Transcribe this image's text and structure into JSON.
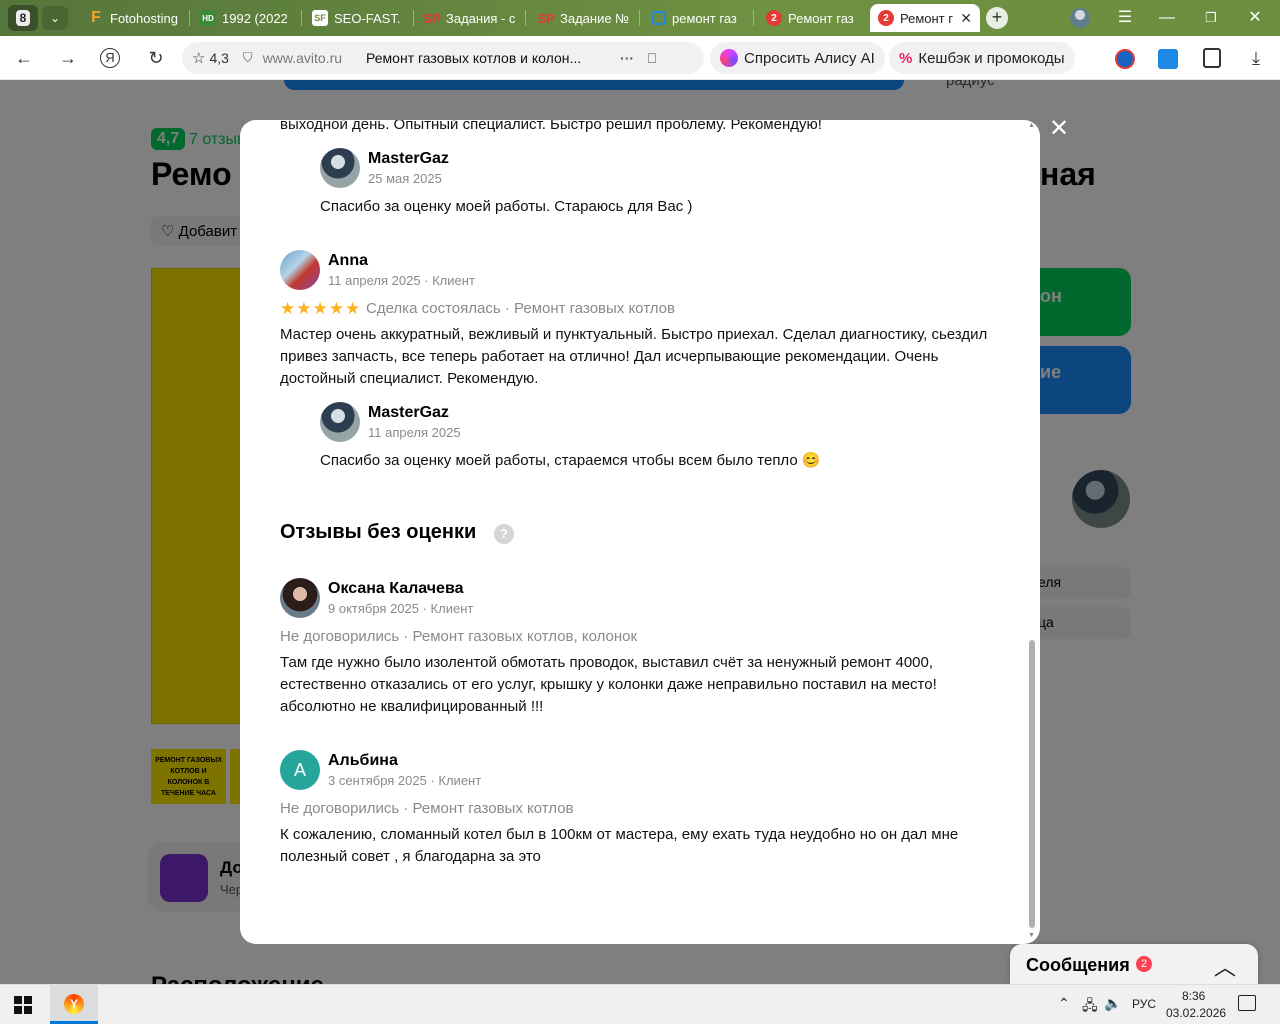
{
  "browser": {
    "tab_counter": "8",
    "tabs": [
      {
        "label": "Fotohosting",
        "fav_text": "F",
        "fav_color": "#f5a623"
      },
      {
        "label": "1992 (2022",
        "fav_text": "HD",
        "fav_color": "#3a8a3a"
      },
      {
        "label": "SEO-FAST.",
        "fav_text": "SF",
        "fav_color": "#ffffff"
      },
      {
        "label": "Задания - с",
        "fav_text": "SP",
        "fav_color": "#e53935"
      },
      {
        "label": "Задание №",
        "fav_text": "SP",
        "fav_color": "#e53935"
      },
      {
        "label": "ремонт газ",
        "fav_text": "",
        "fav_color": "#1e88e5"
      },
      {
        "label": "Ремонт газ",
        "fav_text": "2",
        "fav_color": "#e53935"
      },
      {
        "label": "Ремонт г",
        "fav_text": "2",
        "fav_color": "#e53935"
      }
    ],
    "rating": "4,3",
    "url_domain": "www.avito.ru",
    "page_title": "Ремонт газовых котлов и колон...",
    "alice_label": "Спросить Алису AI",
    "cashback_label": "Кешбэк и промокоды"
  },
  "background": {
    "rating_badge": "4,7",
    "reviews_link": "7 отзыв",
    "title_left": "Ремо",
    "title_right": "ная",
    "add_favorite": "Добавит",
    "radius_label": "радиус",
    "btn_green": "он",
    "btn_blue": "ие",
    "side_item_1": "еля",
    "side_item_2": "ца",
    "thumb_caption": "РЕМОНТ ГАЗОВЫХ КОТЛОВ И КОЛОНОК В ТЕЧЕНИЕ ЧАСА",
    "promo_title": "До",
    "promo_sub": "Чер",
    "section_title": "Расположение",
    "messages_label": "Сообщения",
    "messages_count": "2"
  },
  "modal": {
    "top_text": "выходной день. Опытный специалист. Быстро решил проблему. Рекомендую!",
    "reply1": {
      "name": "MasterGaz",
      "date": "25 мая 2025",
      "text": "Спасибо за оценку моей работы. Стараюсь для Вас )"
    },
    "review_anna": {
      "name": "Anna",
      "meta": "11 апреля 2025 · Клиент",
      "stars": "★★★★★",
      "deal": "Сделка состоялась · Ремонт газовых котлов",
      "text": "Мастер очень аккуратный, вежливый и пунктуальный. Быстро приехал. Сделал диагностику, сьездил привез запчасть, все теперь работает на отлично! Дал исчерпывающие рекомендации. Очень достойный специалист. Рекомендую."
    },
    "reply2": {
      "name": "MasterGaz",
      "date": "11 апреля 2025",
      "text": "Спасибо за оценку моей работы, стараемся чтобы всем было тепло 😊"
    },
    "section_heading": "Отзывы без оценки",
    "help_glyph": "?",
    "review_oksana": {
      "name": "Оксана Калачева",
      "meta": "9 октября 2025 · Клиент",
      "deal": "Не договорились · Ремонт газовых котлов, колонок",
      "text": "Там где нужно было изолентой обмотать проводок, выставил счёт за ненужный ремонт 4000, естественно отказались от его услуг, крышку у колонки даже неправильно поставил на место! абсолютно не квалифицированный !!!"
    },
    "review_albina": {
      "name": "Альбина",
      "initial": "А",
      "meta": "3 сентября 2025 · Клиент",
      "deal": "Не договорились · Ремонт газовых котлов",
      "text": "К сожалению, сломанный котел был в 100км от мастера, ему ехать туда неудобно но он дал мне полезный совет , я благодарна за это"
    }
  },
  "taskbar": {
    "lang": "РУС",
    "time": "8:36",
    "date": "03.02.2026"
  }
}
